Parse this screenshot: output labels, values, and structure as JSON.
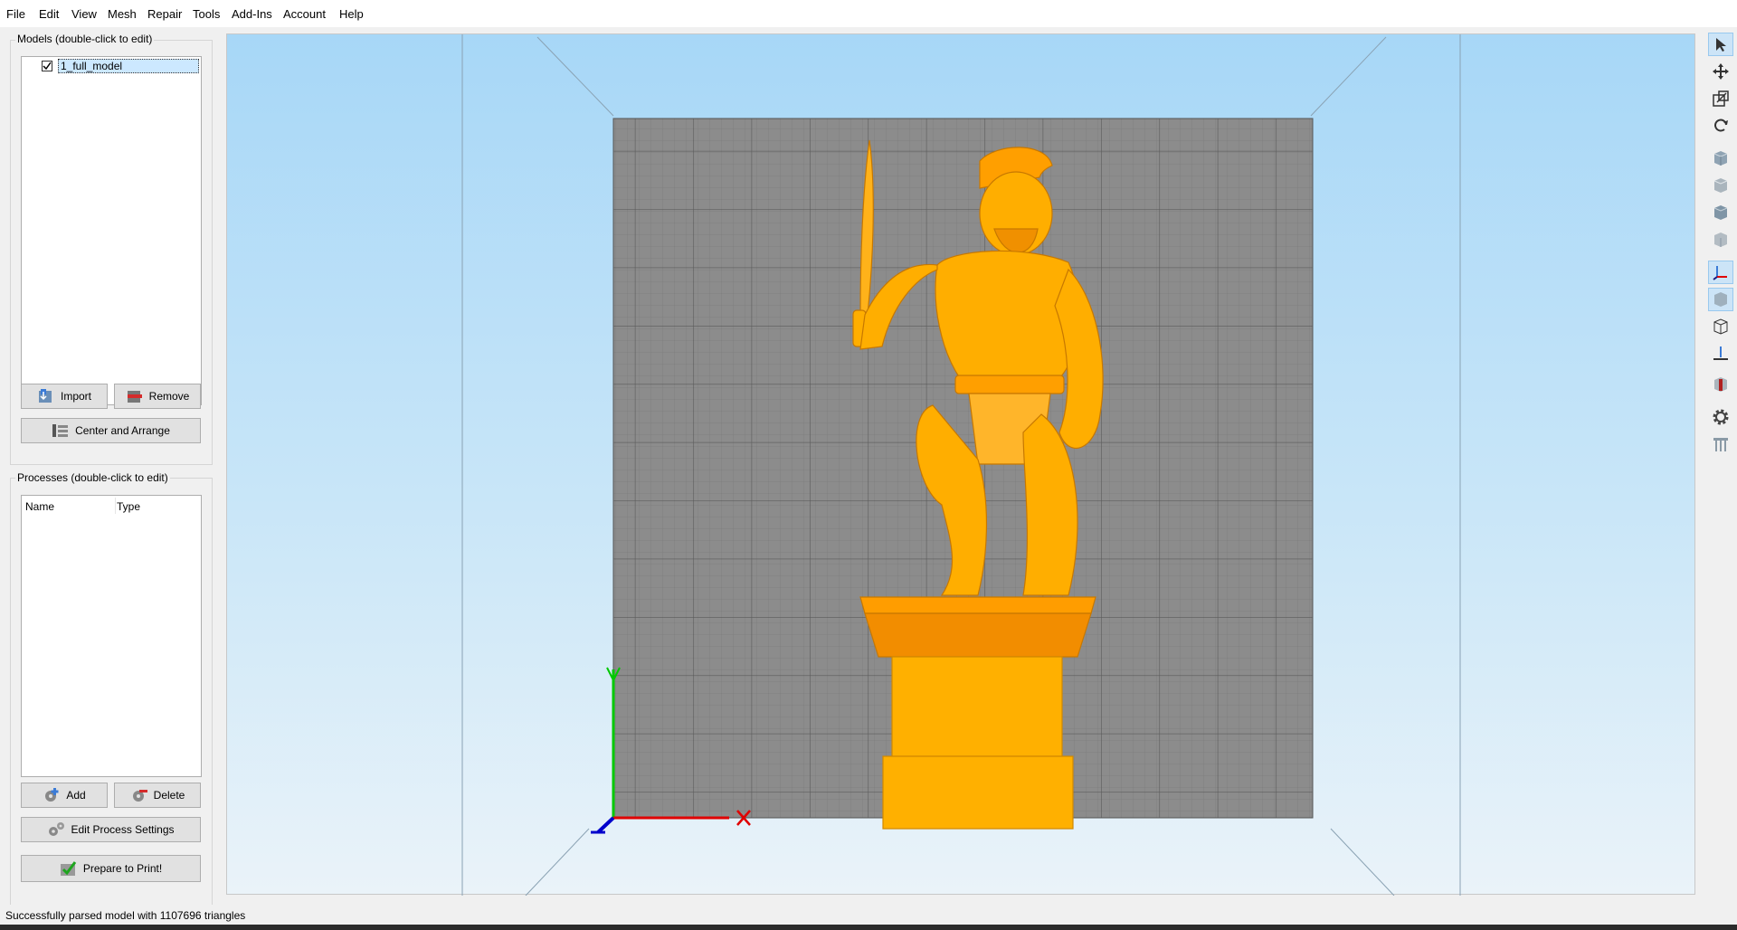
{
  "menu": [
    "File",
    "Edit",
    "View",
    "Mesh",
    "Repair",
    "Tools",
    "Add-Ins",
    "Account",
    "Help"
  ],
  "models": {
    "title": "Models (double-click to edit)",
    "items": [
      {
        "name": "1_full_model",
        "checked": true
      }
    ],
    "import_label": "Import",
    "remove_label": "Remove",
    "center_label": "Center and Arrange"
  },
  "processes": {
    "title": "Processes (double-click to edit)",
    "columns": [
      "Name",
      "Type"
    ],
    "add_label": "Add",
    "delete_label": "Delete",
    "edit_label": "Edit Process Settings",
    "prepare_label": "Prepare to Print!"
  },
  "toolbar": [
    {
      "icon": "select-cursor-icon"
    },
    {
      "icon": "move-icon"
    },
    {
      "icon": "scale-icon"
    },
    {
      "icon": "rotate-icon"
    },
    {
      "icon": "iso-view-icon"
    },
    {
      "icon": "front-view-icon"
    },
    {
      "icon": "top-view-icon"
    },
    {
      "icon": "side-view-icon"
    },
    {
      "icon": "axes-icon"
    },
    {
      "icon": "solid-view-icon"
    },
    {
      "icon": "wireframe-view-icon"
    },
    {
      "icon": "build-plate-icon"
    },
    {
      "icon": "cross-section-icon"
    },
    {
      "icon": "settings-gear-icon"
    },
    {
      "icon": "supports-icon"
    }
  ],
  "status": "Successfully parsed model with 1107696 triangles",
  "colors": {
    "model": "#ffae00",
    "bed": "#8c8c8c",
    "x_axis": "#e00000",
    "y_axis": "#00c800",
    "z_axis": "#0000cc"
  }
}
